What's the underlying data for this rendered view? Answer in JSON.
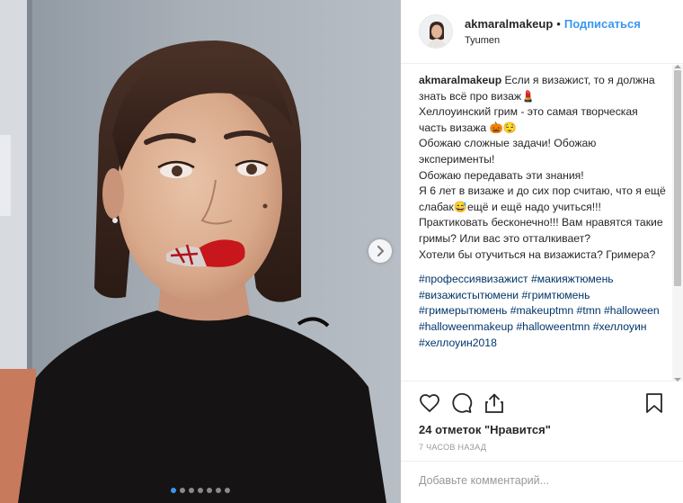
{
  "post": {
    "username": "akmaralmakeup",
    "follow_label": "Подписаться",
    "separator": "•",
    "location": "Tyumen",
    "caption": {
      "username": "akmaralmakeup",
      "text": " Если я визажист, то я должна знать всё про визаж💄\nХеллоуинский грим - это самая творческая часть визажа 🎃😌\nОбожаю сложные задачи! Обожаю эксперименты!\nОбожаю передавать эти знания!\nЯ 6 лет в визаже и до сих пор считаю, что я ещё слабак😅ещё и ещё надо учиться!!!\nПрактиковать бесконечно!!! Вам нравятся такие гримы? Или вас это отталкивает?\nХотели бы отучиться на визажиста? Гримера?",
      "hashtags": "#профессиявизажист #макияжтюмень #визажистытюмени #гримтюмень #гримерытюмень #makeuptmn #tmn #halloween #halloweenmakeup #halloweentmn #хеллоуин #хеллоуин2018"
    },
    "likes": "24 отметок \"Нравится\"",
    "time_ago": "7 ЧАСОВ НАЗАД",
    "comment_placeholder": "Добавьте комментарий...",
    "carousel": {
      "total": 7,
      "active_index": 0
    }
  },
  "icons": {
    "like": "heart-icon",
    "comment": "comment-bubble-icon",
    "share": "share-icon",
    "save": "bookmark-icon",
    "next": "chevron-right-icon"
  },
  "colors": {
    "accent": "#3897f0",
    "text": "#262626",
    "muted": "#999999",
    "hashtag": "#003569",
    "lips": "#c8161d"
  }
}
